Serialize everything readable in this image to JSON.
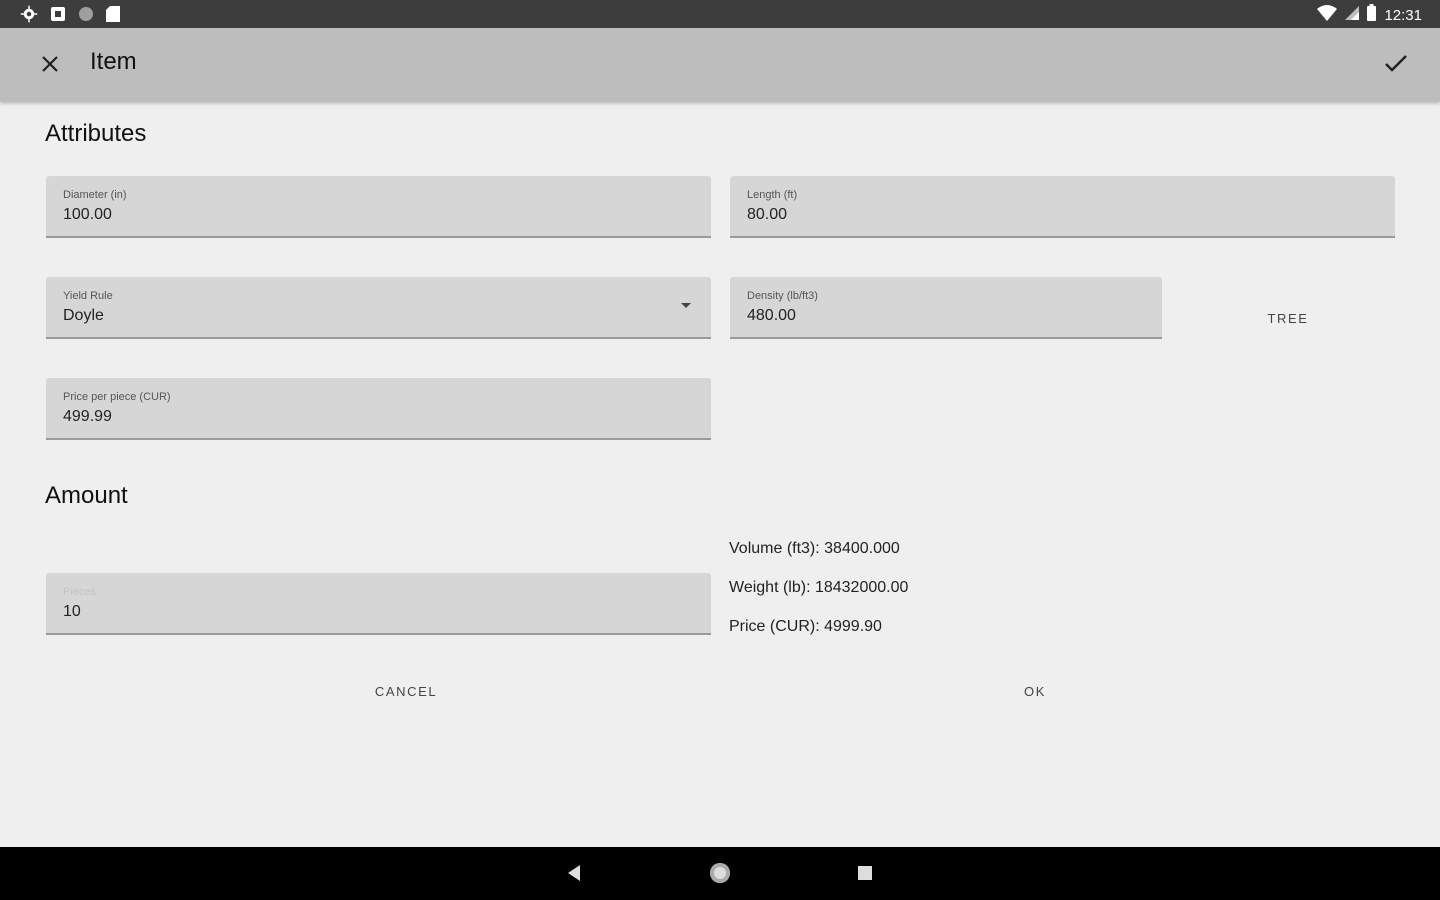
{
  "status_bar": {
    "time": "12:31",
    "left_icons": [
      "settings-icon",
      "notification-icon",
      "circle-icon",
      "sd-card-icon"
    ],
    "right_icons": [
      "wifi-icon",
      "signal-icon",
      "battery-icon"
    ]
  },
  "app_bar": {
    "title": "Item",
    "close_icon": "close-icon",
    "confirm_icon": "check-icon"
  },
  "attributes": {
    "title": "Attributes",
    "diameter": {
      "label": "Diameter (in)",
      "value": "100.00"
    },
    "length": {
      "label": "Length (ft)",
      "value": "80.00"
    },
    "yield_rule": {
      "label": "Yield Rule",
      "value": "Doyle"
    },
    "density": {
      "label": "Density (lb/ft3)",
      "value": "480.00"
    },
    "tree_button": "TREE",
    "price_per_piece": {
      "label": "Price per piece (CUR)",
      "value": "499.99"
    }
  },
  "amount": {
    "title": "Amount",
    "pieces": {
      "label": "Pieces",
      "value": "10"
    },
    "volume": "Volume (ft3): 38400.000",
    "weight": "Weight (lb): 18432000.00",
    "price": "Price (CUR): 4999.90"
  },
  "actions": {
    "cancel": "CANCEL",
    "ok": "OK"
  },
  "colors": {
    "status_bar": "#3d3d3d",
    "app_bar": "#bdbdbd",
    "background": "#efefef",
    "field": "#d6d6d6",
    "nav_bar": "#000000"
  }
}
